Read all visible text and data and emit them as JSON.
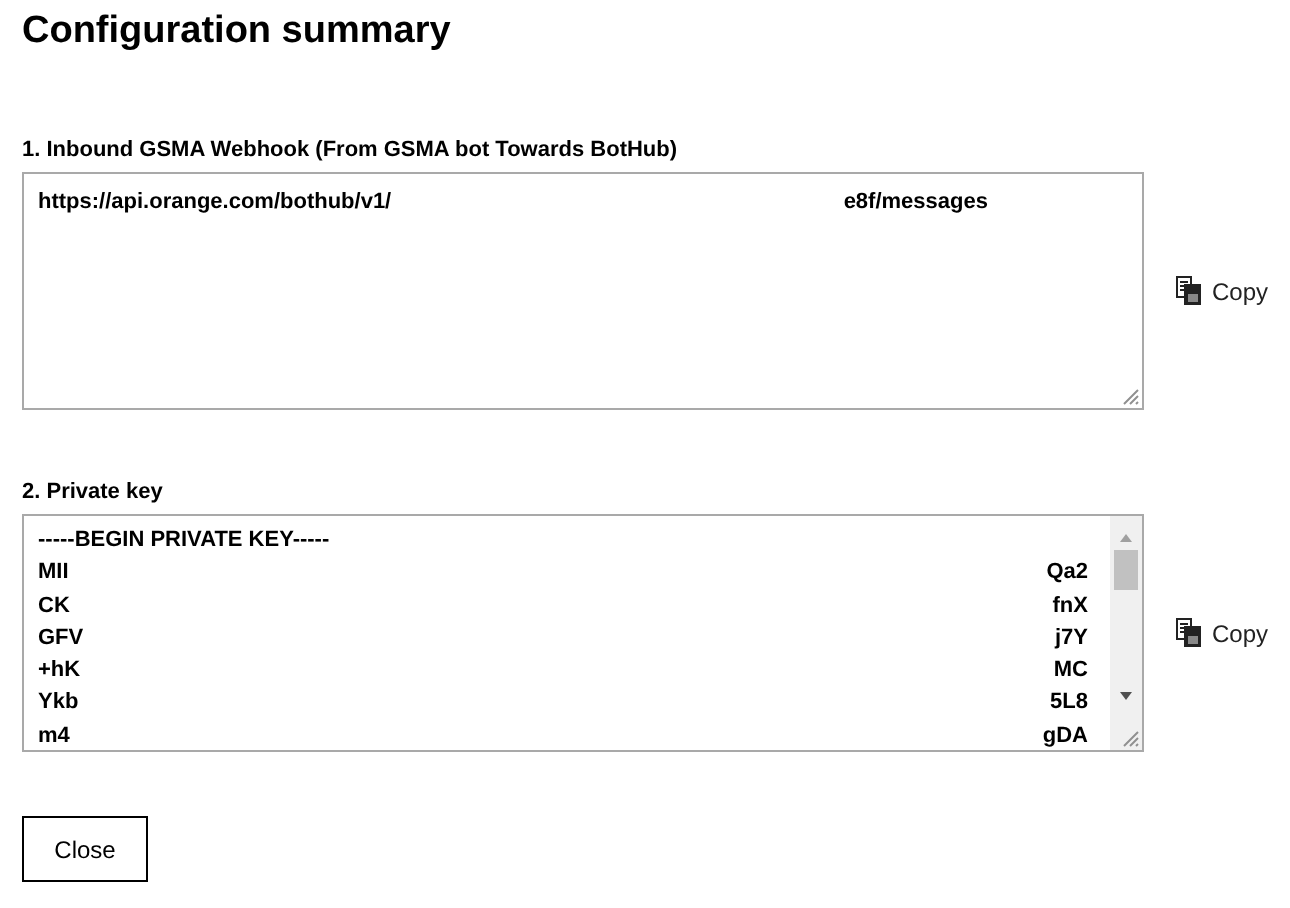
{
  "title": "Configuration summary",
  "fields": [
    {
      "label": "1. Inbound GSMA Webhook (From GSMA bot Towards BotHub)",
      "kind": "url",
      "lines": [
        {
          "start": "https://api.orange.com/bothub/v1/",
          "end": "e8f/messages"
        }
      ],
      "copy": "Copy"
    },
    {
      "label": "2. Private key",
      "kind": "key",
      "lines": [
        {
          "start": "-----BEGIN PRIVATE KEY-----"
        },
        {
          "start": "MII",
          "end": "Qa2"
        },
        {
          "start": "CK",
          "end": "fnX"
        },
        {
          "start": "GFV",
          "end": "j7Y"
        },
        {
          "start": "+hK",
          "end": "MC"
        },
        {
          "start": "Ykb",
          "end": "5L8"
        },
        {
          "start": "m4",
          "end": "gDA"
        }
      ],
      "copy": "Copy"
    }
  ],
  "close": "Close"
}
